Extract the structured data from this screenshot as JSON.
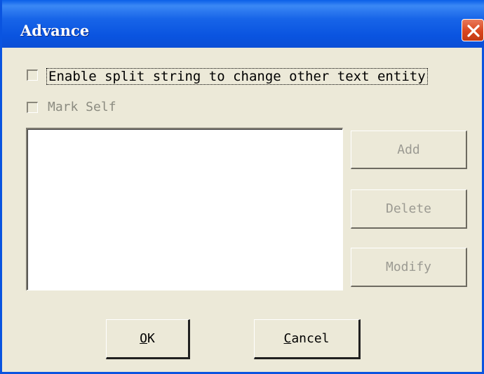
{
  "window": {
    "title": "Advance"
  },
  "options": {
    "split_label": "Enable split string to change other text entity",
    "mark_self_label": "Mark Self"
  },
  "side_buttons": {
    "add": "Add",
    "delete": "Delete",
    "modify": "Modify"
  },
  "footer": {
    "ok_mnemonic": "O",
    "ok_rest": "K",
    "cancel_mnemonic": "C",
    "cancel_rest": "ancel"
  },
  "colors": {
    "title_bar": "#0a54e0",
    "close_button": "#d9461f",
    "dialog_face": "#ece9d8"
  },
  "icons": {
    "close": "close-x-icon"
  }
}
